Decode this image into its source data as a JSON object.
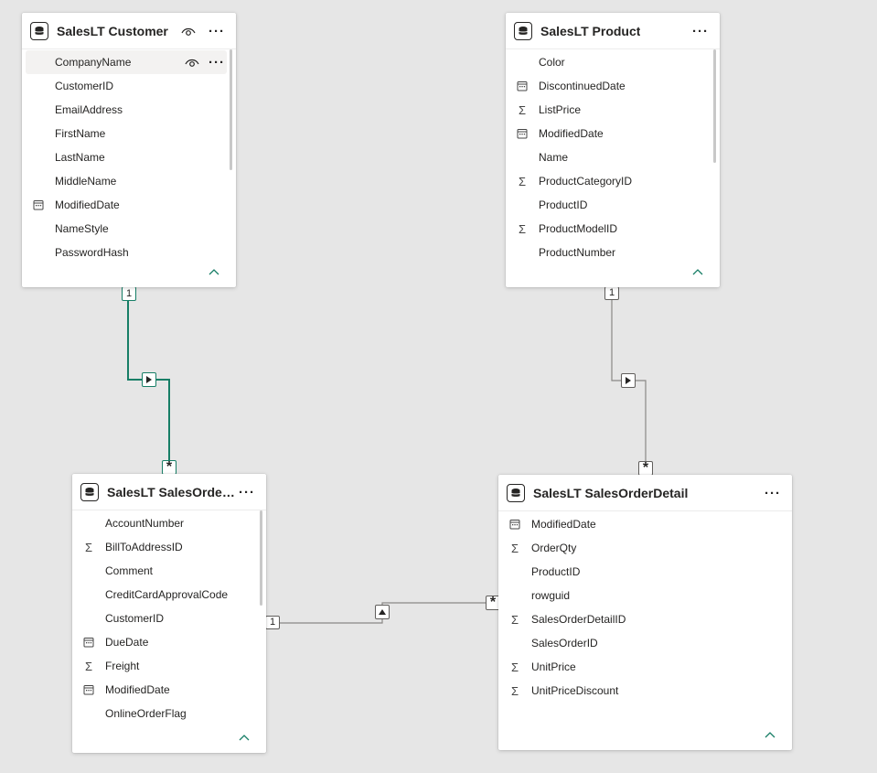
{
  "colors": {
    "canvas": "#e6e6e6",
    "active_relationship": "#177e66",
    "inactive_relationship": "#8a8886",
    "collapse_chevron": "#177e66"
  },
  "tables": {
    "customer": {
      "title": "SalesLT Customer",
      "fields": [
        {
          "name": "CompanyName",
          "icon": "none"
        },
        {
          "name": "CustomerID",
          "icon": "none"
        },
        {
          "name": "EmailAddress",
          "icon": "none"
        },
        {
          "name": "FirstName",
          "icon": "none"
        },
        {
          "name": "LastName",
          "icon": "none"
        },
        {
          "name": "MiddleName",
          "icon": "none"
        },
        {
          "name": "ModifiedDate",
          "icon": "calendar-icon"
        },
        {
          "name": "NameStyle",
          "icon": "none"
        },
        {
          "name": "PasswordHash",
          "icon": "none"
        }
      ]
    },
    "product": {
      "title": "SalesLT Product",
      "fields": [
        {
          "name": "Color",
          "icon": "none"
        },
        {
          "name": "DiscontinuedDate",
          "icon": "calendar-icon"
        },
        {
          "name": "ListPrice",
          "icon": "sigma-icon"
        },
        {
          "name": "ModifiedDate",
          "icon": "calendar-icon"
        },
        {
          "name": "Name",
          "icon": "none"
        },
        {
          "name": "ProductCategoryID",
          "icon": "sigma-icon"
        },
        {
          "name": "ProductID",
          "icon": "none"
        },
        {
          "name": "ProductModelID",
          "icon": "sigma-icon"
        },
        {
          "name": "ProductNumber",
          "icon": "none"
        }
      ]
    },
    "order_header": {
      "title": "SalesLT SalesOrderH...",
      "fields": [
        {
          "name": "AccountNumber",
          "icon": "none"
        },
        {
          "name": "BillToAddressID",
          "icon": "sigma-icon"
        },
        {
          "name": "Comment",
          "icon": "none"
        },
        {
          "name": "CreditCardApprovalCode",
          "icon": "none"
        },
        {
          "name": "CustomerID",
          "icon": "none"
        },
        {
          "name": "DueDate",
          "icon": "calendar-icon"
        },
        {
          "name": "Freight",
          "icon": "sigma-icon"
        },
        {
          "name": "ModifiedDate",
          "icon": "calendar-icon"
        },
        {
          "name": "OnlineOrderFlag",
          "icon": "none"
        }
      ]
    },
    "order_detail": {
      "title": "SalesLT SalesOrderDetail",
      "fields": [
        {
          "name": "ModifiedDate",
          "icon": "calendar-icon"
        },
        {
          "name": "OrderQty",
          "icon": "sigma-icon"
        },
        {
          "name": "ProductID",
          "icon": "none"
        },
        {
          "name": "rowguid",
          "icon": "none"
        },
        {
          "name": "SalesOrderDetailID",
          "icon": "sigma-icon"
        },
        {
          "name": "SalesOrderID",
          "icon": "none"
        },
        {
          "name": "UnitPrice",
          "icon": "sigma-icon"
        },
        {
          "name": "UnitPriceDiscount",
          "icon": "sigma-icon"
        }
      ]
    }
  },
  "relationships": [
    {
      "from": "customer",
      "to": "order_header",
      "one": "1",
      "many": "*",
      "direction": "right",
      "active": true
    },
    {
      "from": "product",
      "to": "order_detail",
      "one": "1",
      "many": "*",
      "direction": "right",
      "active": false
    },
    {
      "from": "order_header",
      "to": "order_detail",
      "one": "1",
      "many": "*",
      "direction": "up",
      "active": false
    }
  ]
}
